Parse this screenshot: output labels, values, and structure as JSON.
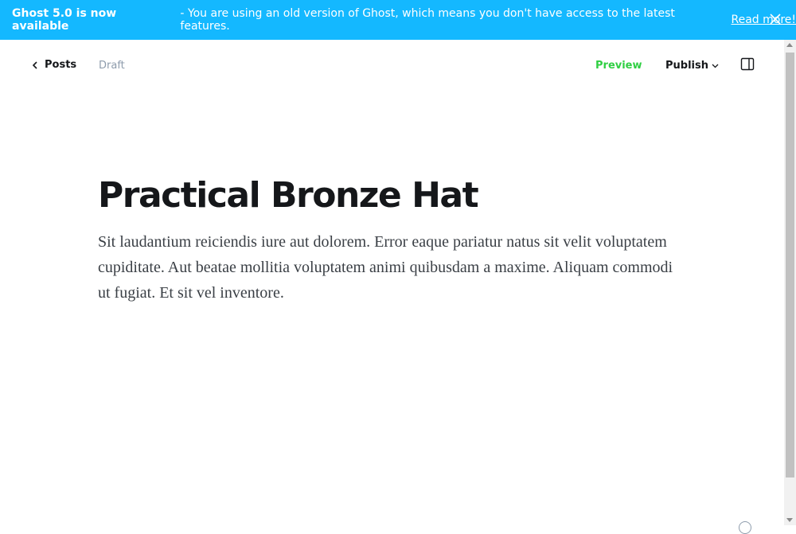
{
  "banner": {
    "bold": "Ghost 5.0 is now available",
    "message": "- You are using an old version of Ghost, which means you don't have access to the latest features.",
    "link": "Read more!",
    "bg_color": "#14b8ff"
  },
  "topbar": {
    "back_label": "Posts",
    "status": "Draft",
    "preview_label": "Preview",
    "publish_label": "Publish"
  },
  "post": {
    "title": "Practical Bronze Hat",
    "body": "Sit laudantium reiciendis iure aut dolorem. Error eaque pariatur natus sit velit voluptatem cupiditate. Aut beatae mollitia voluptatem animi quibusdam a maxime. Aliquam commodi ut fugiat. Et sit vel inventore."
  },
  "colors": {
    "accent_green": "#30cf43",
    "text_dark": "#15171a",
    "muted": "#8e9cac"
  }
}
